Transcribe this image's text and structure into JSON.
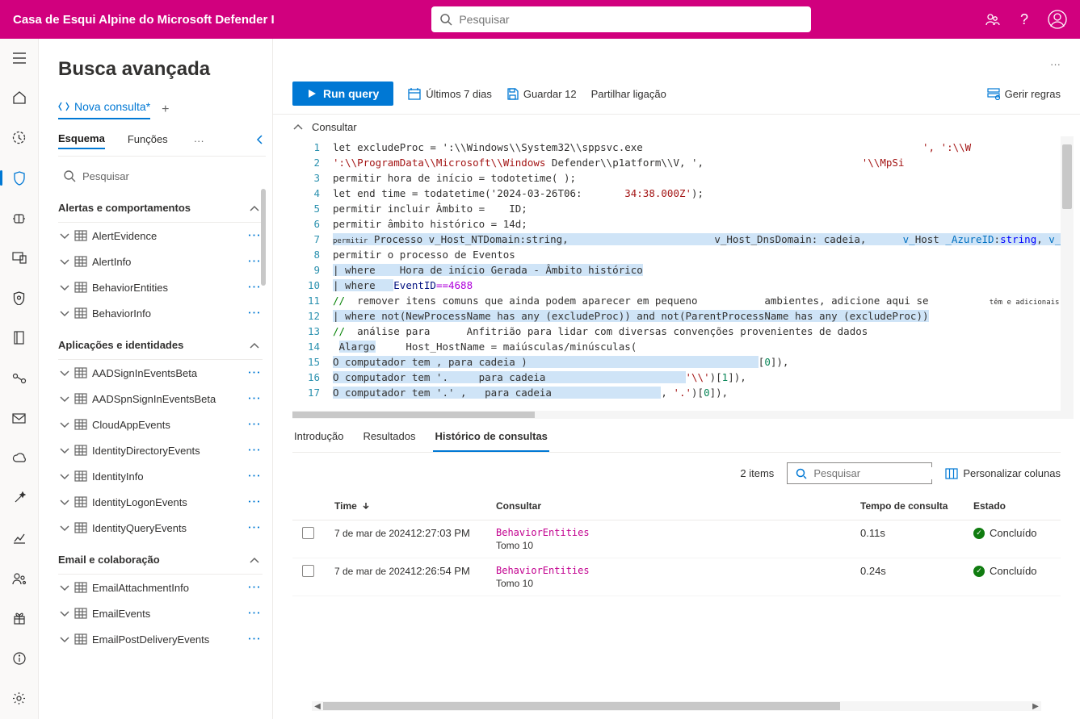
{
  "header": {
    "brand": "Casa de Esqui Alpine do Microsoft Defender I",
    "search_placeholder": "Pesquisar"
  },
  "page": {
    "title": "Busca avançada",
    "new_query_tab": "Nova consulta*"
  },
  "schema_tabs": {
    "schema": "Esquema",
    "functions": "Funções"
  },
  "mini_search": "Pesquisar",
  "sections": [
    {
      "title": "Alertas e comportamentos",
      "items": [
        "AlertEvidence",
        "AlertInfo",
        "BehaviorEntities",
        "BehaviorInfo"
      ]
    },
    {
      "title": "Aplicações e identidades",
      "items": [
        "AADSignInEventsBeta",
        "AADSpnSignInEventsBeta",
        "CloudAppEvents",
        "IdentityDirectoryEvents",
        "IdentityInfo",
        "IdentityLogonEvents",
        "IdentityQueryEvents"
      ]
    },
    {
      "title": "Email e colaboração",
      "items": [
        "EmailAttachmentInfo",
        "EmailEvents",
        "EmailPostDeliveryEvents"
      ]
    }
  ],
  "toolbar": {
    "run": "Run query",
    "last7": "Últimos 7 dias",
    "save": "Guardar 12",
    "share": "Partilhar ligação",
    "rules": "Gerir regras"
  },
  "query_label": "Consultar",
  "code_lines": [
    {
      "n": 1,
      "html": "let excludeProc = ':\\\\Windows\\\\System32\\\\sppsvc.exe                                              <span class='str'>', ':\\\\W</span>"
    },
    {
      "n": 2,
      "html": "<span class='str'>':\\\\ProgramData\\\\Microsoft\\\\Windows</span> Defender\\\\p1atform\\\\V, ',                          <span class='str'>'\\\\MpSi</span>"
    },
    {
      "n": 3,
      "html": "permitir hora de início = todotetime( );"
    },
    {
      "n": 4,
      "html": "let end time = todatetime('2024-03-26T06:       <span class='str'>34:38.000Z'</span>);"
    },
    {
      "n": 5,
      "html": "permitir incluir Âmbito =    ID;"
    },
    {
      "n": 6,
      "html": "permitir âmbito histórico = 14d;"
    },
    {
      "n": 7,
      "html": "<span class='sel'><span style='font-size:9px'>permitir</span> Processo v_Host_NTDomain:string,                        v_Host_DnsDomain: cadeia,      <span class='lblue'>v_</span>Host <span class='lblue'>_AzureID</span>:<span class='kw'>string</span>, <span class='lblue'>v_</span></span>"
    },
    {
      "n": 8,
      "html": "permitir o processo de Eventos"
    },
    {
      "n": 9,
      "html": "<span class='sel'>| where    Hora de início Gerada - Âmbito histórico</span>"
    },
    {
      "n": 10,
      "html": "<span class='sel'>| where   </span><span class='id'>EventID</span><span class='pink'>==4688</span>"
    },
    {
      "n": 11,
      "html": "<span class='cmt'>//</span>  remover itens comuns que ainda podem aparecer em pequeno           ambientes, adicione aqui se          <span style='font-size:9px'>têm e adicionais</span>"
    },
    {
      "n": 12,
      "html": "<span class='sel'>| where not(NewProcessName has any (excludeProc)) and not(ParentProcessName has any (excludeProc))</span>"
    },
    {
      "n": 13,
      "html": "<span class='cmt'>//</span>  análise para      Anfitrião para lidar com diversas convenções provenientes de dados"
    },
    {
      "n": 14,
      "html": " <span class='sel'>Alargo</span>     Host_HostName = maiúsculas/minúsculas("
    },
    {
      "n": 15,
      "html": "<span class='sel'>O computador tem , para cadeia )                                      </span>[<span class='num'>0</span>]),"
    },
    {
      "n": 16,
      "html": "<span class='sel'>O computador tem '.     para cadeia                       </span><span class='str'>'\\\\'</span>)[<span class='num'>1</span>]),"
    },
    {
      "n": 17,
      "html": "<span class='sel'>O computador tem '.' ,   para cadeia                  </span>, <span class='str'>'.'</span>)[<span class='num'>0</span>]),"
    }
  ],
  "results": {
    "tabs": {
      "intro": "Introdução",
      "results": "Resultados",
      "history": "Histórico de consultas"
    },
    "count": "2",
    "count_label": "items",
    "search_placeholder": "Pesquisar",
    "custom_cols": "Personalizar colunas",
    "columns": {
      "time": "Time",
      "query": "Consultar",
      "qtime": "Tempo de consulta",
      "status": "Estado"
    },
    "rows": [
      {
        "date": "7 de mar de 2024",
        "time": "12:27:03 PM",
        "q": "BehaviorEntities",
        "q2": "Tomo 10",
        "dur": "0.11s",
        "status": "Concluído"
      },
      {
        "date": "7 de mar de 2024",
        "time": "12:26:54 PM",
        "q": "BehaviorEntities",
        "q2": "Tomo 10",
        "dur": "0.24s",
        "status": "Concluído"
      }
    ]
  }
}
